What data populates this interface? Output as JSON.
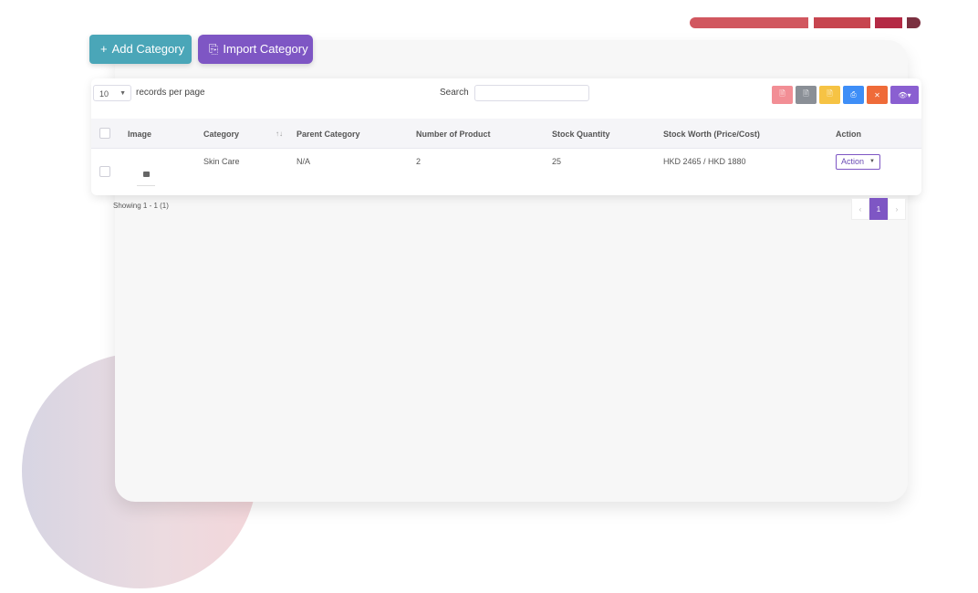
{
  "toolbar": {
    "add_label": "Add Category",
    "add_icon": "plus-icon",
    "import_label": "Import Category",
    "import_icon": "copy-icon"
  },
  "table_controls": {
    "page_length": "10",
    "records_label": "records per page",
    "search_label": "Search",
    "search_value": ""
  },
  "export_tools": [
    {
      "name": "pdf-icon",
      "color": "#f28e95"
    },
    {
      "name": "csv-icon",
      "color": "#8a8f96"
    },
    {
      "name": "excel-icon",
      "color": "#f6c344"
    },
    {
      "name": "print-icon",
      "color": "#3e8ef7"
    },
    {
      "name": "close-icon",
      "color": "#ef6b39"
    },
    {
      "name": "eye-icon",
      "color": "#8a5fd1"
    }
  ],
  "columns": {
    "image": "Image",
    "category": "Category",
    "parent": "Parent Category",
    "products": "Number of Product",
    "stock": "Stock Quantity",
    "worth": "Stock Worth (Price/Cost)",
    "action": "Action"
  },
  "rows": [
    {
      "category": "Skin Care",
      "parent": "N/A",
      "products": "2",
      "stock": "25",
      "worth": "HKD 2465 / HKD 1880",
      "action_label": "Action"
    }
  ],
  "footer": {
    "showing": "Showing 1 - 1 (1)",
    "prev": "‹",
    "current_page": "1",
    "next": "›"
  },
  "colors": {
    "accent": "#7e56c4",
    "add_button": "#4aa6b8"
  }
}
